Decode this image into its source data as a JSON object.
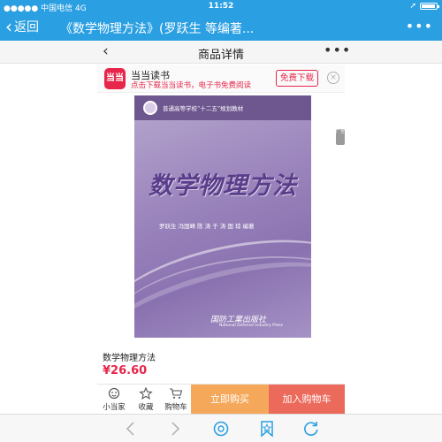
{
  "status_bar": {
    "carrier": "●●●●● 中国电信  4G",
    "time": "11:52"
  },
  "browser": {
    "back_label": "返回",
    "title": "《数学物理方法》(罗跃生 等编著...",
    "more_label": "•••"
  },
  "page_nav": {
    "back_glyph": "‹",
    "title": "商品详情",
    "more_label": "•••"
  },
  "app_banner": {
    "logo_text": "当当",
    "name": "当当读书",
    "tagline": "点击下载当当读书，电子书免费阅读",
    "download_label": "免费下载",
    "close_glyph": "×"
  },
  "book_cover": {
    "series": "普通高等学校“十二五”规划教材",
    "title": "数学物理方法",
    "authors": "罗跃生  冯国峰  陈 涛  于 涛  国 琼  编著",
    "publisher": "国防工業出版社",
    "publisher_en": "National Defense Industry Press"
  },
  "side_tab": "广告",
  "product": {
    "name": "数学物理方法",
    "price": "¥26.60"
  },
  "action_bar": {
    "home_label": "小当家",
    "favorite_label": "收藏",
    "cart_icon_label": "购物车",
    "buy_label": "立即购买",
    "add_cart_label": "加入购物车"
  },
  "colors": {
    "accent_blue": "#2a9fe2",
    "brand_red": "#e6264b",
    "buy_orange": "#f6a85a",
    "cart_red": "#ec6a5c"
  },
  "icons": {
    "home": "home-icon",
    "favorite": "star-icon",
    "cart": "cart-icon",
    "back": "chevron-left-icon",
    "forward": "chevron-right-icon",
    "search": "search-icon",
    "bookmark": "bookmark-icon",
    "refresh": "refresh-icon"
  }
}
